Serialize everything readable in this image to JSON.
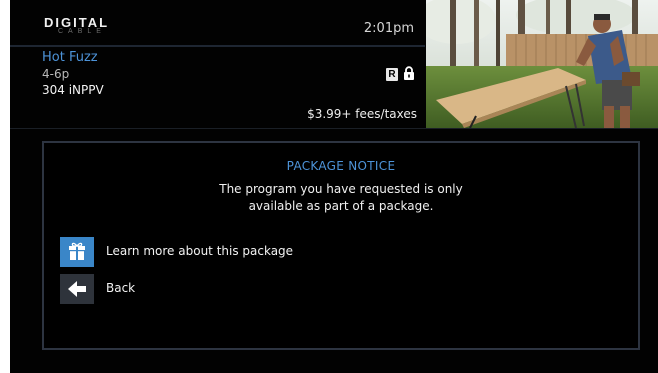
{
  "header": {
    "logo": {
      "main": "DIGITAL",
      "sub": "CABLE"
    },
    "time": "2:01pm",
    "program": {
      "title": "Hot Fuzz",
      "time": "4-6p",
      "channel": "304 iNPPV",
      "rating": "R",
      "price": "$3.99+ fees/taxes"
    },
    "icons": {
      "lock": "lock-icon"
    }
  },
  "dialog": {
    "title": "PACKAGE NOTICE",
    "message_line1": "The program you have requested is only",
    "message_line2": "available as part of a package.",
    "options": [
      {
        "label": "Learn more about this package",
        "icon": "gift-package-icon",
        "color": "#3a86c8"
      },
      {
        "label": "Back",
        "icon": "back-arrow-icon",
        "color": "#2e333b"
      }
    ]
  },
  "colors": {
    "accent": "#4d93d8",
    "background": "#020202",
    "dialog_border": "#2d3441"
  }
}
